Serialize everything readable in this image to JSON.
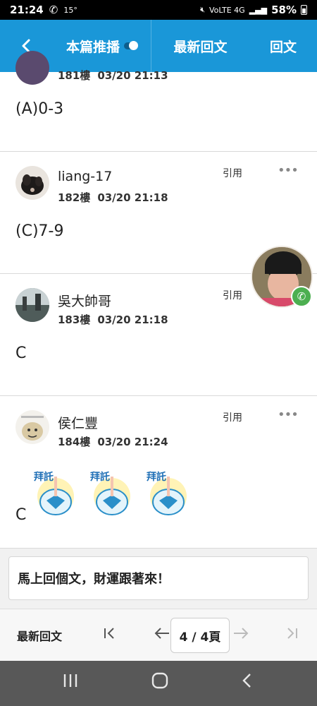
{
  "status_bar": {
    "time": "21:24",
    "temp": "15°",
    "network": "VoLTE 4G",
    "battery": "58%"
  },
  "header": {
    "tabs": [
      {
        "label": "本篇推播"
      },
      {
        "label": "最新回文"
      },
      {
        "label": "回文"
      }
    ]
  },
  "posts": [
    {
      "floor": "181樓",
      "datetime": "03/20 21:13",
      "content": "(A)0-3"
    },
    {
      "author": "liang-17",
      "floor": "182樓",
      "datetime": "03/20 21:18",
      "content": "(C)7-9",
      "quote_label": "引用",
      "more": "•••"
    },
    {
      "author": "吳大帥哥",
      "floor": "183樓",
      "datetime": "03/20 21:18",
      "content": "C",
      "quote_label": "引用",
      "more": "•••"
    },
    {
      "author": "侯仁豐",
      "floor": "184樓",
      "datetime": "03/20 21:24",
      "content": "C",
      "quote_label": "引用",
      "more": "•••",
      "stickers": [
        {
          "text": "拜託"
        },
        {
          "text": "拜託"
        },
        {
          "text": "拜託"
        }
      ]
    }
  ],
  "reply": {
    "text": "馬上回個文，財運跟著來！"
  },
  "pager": {
    "latest_label": "最新回文",
    "page_display": "4 / 4頁",
    "current_page": 4,
    "total_pages": 4
  },
  "colors": {
    "header_bg": "#1a97d8",
    "call_green": "#4caf50"
  }
}
